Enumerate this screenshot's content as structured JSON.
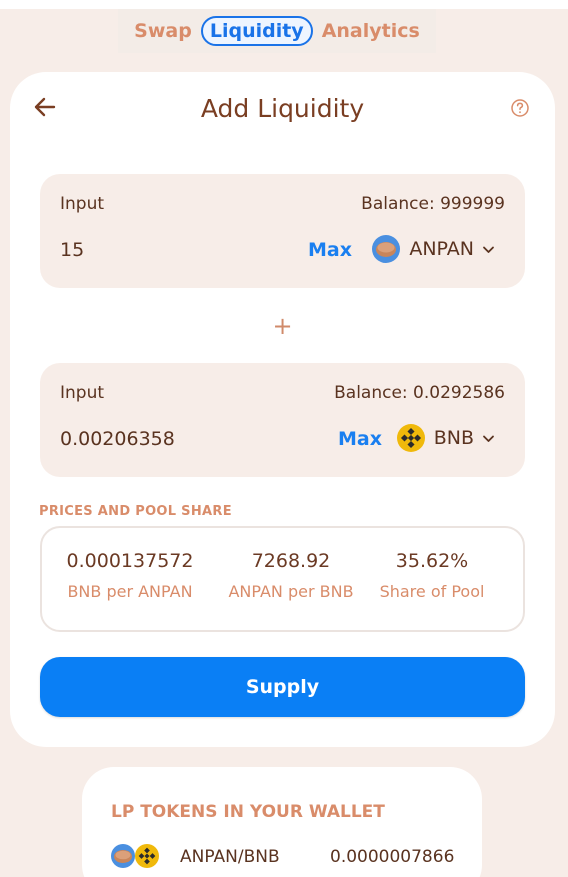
{
  "nav": {
    "tabs": [
      {
        "label": "Swap",
        "active": false
      },
      {
        "label": "Liquidity",
        "active": true
      },
      {
        "label": "Analytics",
        "active": false
      }
    ]
  },
  "header": {
    "title": "Add Liquidity",
    "back_icon": "arrow-left-icon",
    "help_icon": "question-circle-icon"
  },
  "input_a": {
    "label": "Input",
    "balance": "Balance: 999999",
    "value": "15",
    "max_label": "Max",
    "token": "ANPAN",
    "token_icon": "anpan-token-icon"
  },
  "plus_symbol": "+",
  "input_b": {
    "label": "Input",
    "balance": "Balance: 0.0292586",
    "value": "0.00206358",
    "max_label": "Max",
    "token": "BNB",
    "token_icon": "bnb-token-icon"
  },
  "prices": {
    "heading": "PRICES AND POOL SHARE",
    "items": [
      {
        "value": "0.000137572",
        "label": "BNB per ANPAN"
      },
      {
        "value": "7268.92",
        "label": "ANPAN per BNB"
      },
      {
        "value": "35.62%",
        "label": "Share of Pool"
      }
    ]
  },
  "supply_label": "Supply",
  "lp": {
    "title": "LP TOKENS IN YOUR WALLET",
    "pair": "ANPAN/BNB",
    "amount": "0.0000007866"
  },
  "colors": {
    "background": "#f7ede8",
    "accent_blue": "#0a7ff5",
    "label_orange": "#d98c6a",
    "text_brown": "#6b3a24",
    "bnb_yellow": "#f0b90b"
  }
}
